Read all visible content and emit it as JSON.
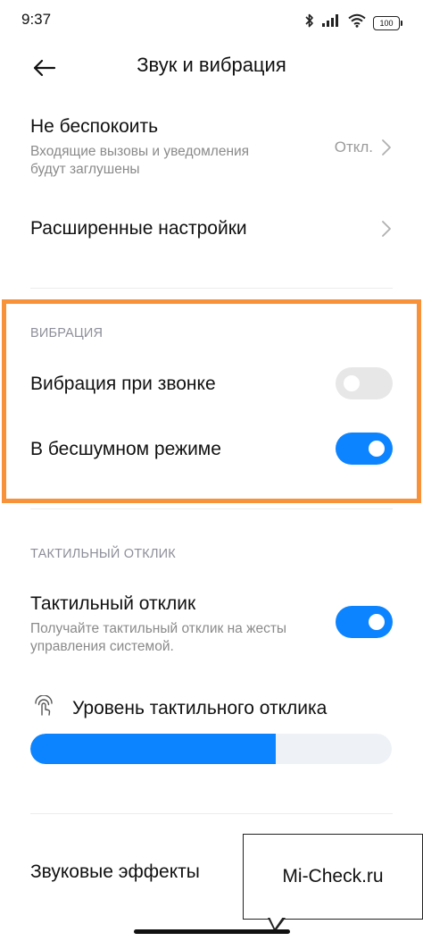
{
  "status_bar": {
    "time": "9:37",
    "battery": "100",
    "icons": [
      "bluetooth-icon",
      "signal-icon",
      "wifi-icon",
      "battery-icon"
    ]
  },
  "header": {
    "title": "Звук и вибрация",
    "back_icon": "back-arrow-icon"
  },
  "settings": {
    "dnd": {
      "title": "Не беспокоить",
      "subtitle_line1": "Входящие вызовы и уведомления",
      "subtitle_line2": "будут заглушены",
      "value": "Откл."
    },
    "advanced": {
      "title": "Расширенные настройки"
    }
  },
  "vibration": {
    "section_label": "ВИБРАЦИЯ",
    "on_call": {
      "title": "Вибрация при звонке",
      "enabled": false
    },
    "silent_mode": {
      "title": "В бесшумном режиме",
      "enabled": true
    },
    "highlight_color": "#f7923a"
  },
  "haptics": {
    "section_label": "ТАКТИЛЬНЫЙ ОТКЛИК",
    "haptic_feedback": {
      "title": "Тактильный отклик",
      "subtitle_line1": "Получайте тактильный отклик на жесты",
      "subtitle_line2": "управления системой.",
      "enabled": true
    },
    "level": {
      "title": "Уровень тактильного отклика",
      "icon": "touch-haptic-icon",
      "value_fraction": 0.68
    }
  },
  "sound_effects": {
    "title": "Звуковые эффекты"
  },
  "watermark": {
    "text": "Mi-Check.ru"
  },
  "colors": {
    "accent": "#0d84ff",
    "toggle_off": "#e7e7e7",
    "secondary_text": "#8a8a8a"
  }
}
